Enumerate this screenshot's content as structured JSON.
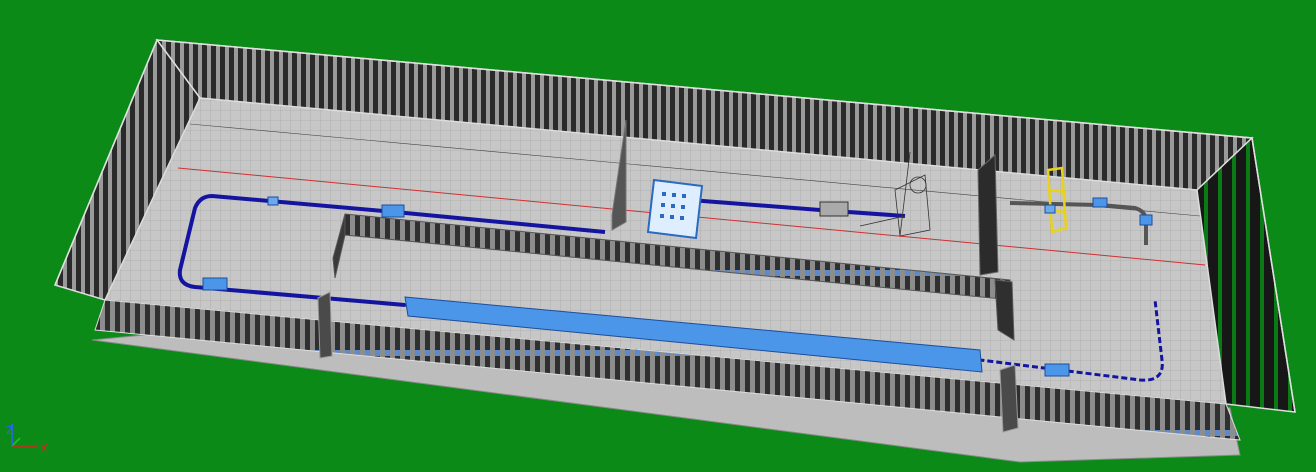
{
  "viewport": {
    "background_color": "#0b8a18",
    "floor_color": "#c9c9c9",
    "grid_color": "#9a9a9a",
    "wall_light": "#8e8e8e",
    "wall_dark": "#1a1a1a",
    "conveyor_color": "#1414a0",
    "machine_color": "#4c96ea",
    "safety_line_color": "#d03030",
    "gantry_color": "#e8d21a"
  },
  "axis_triad": {
    "x_label": "X",
    "z_label": "Z",
    "x_color": "#e02020",
    "y_color": "#20c020",
    "z_color": "#3060ff"
  }
}
